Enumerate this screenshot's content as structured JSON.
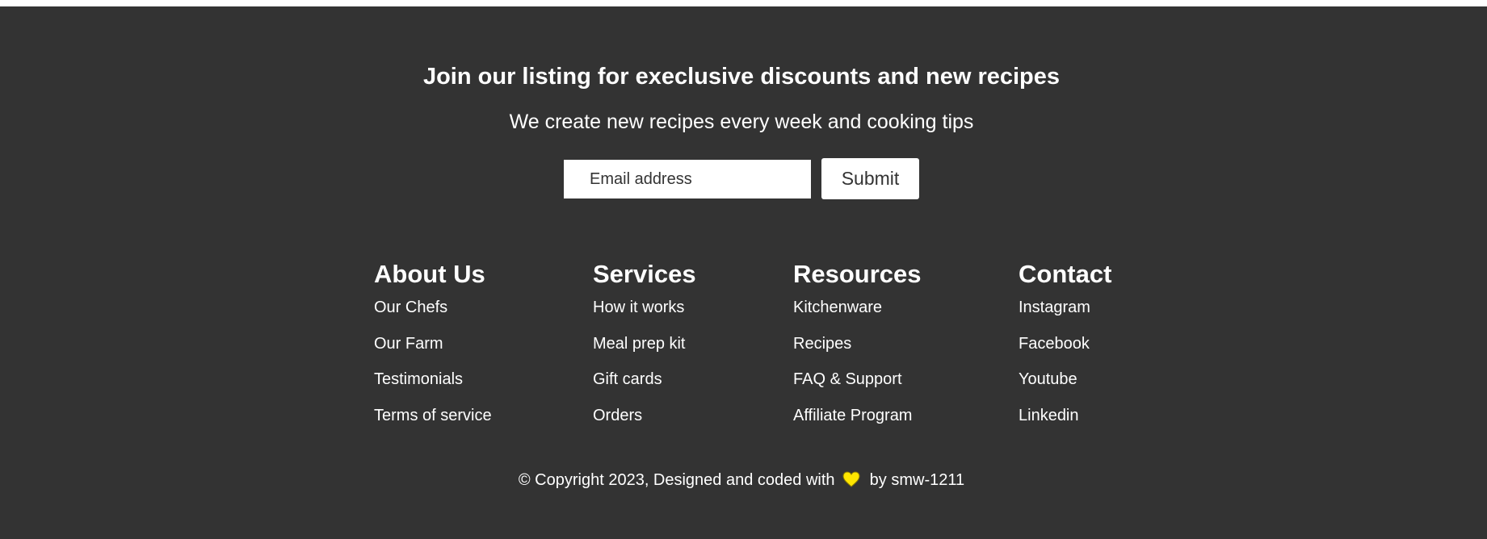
{
  "newsletter": {
    "title": "Join our listing for execlusive discounts and new recipes",
    "subtitle": "We create new recipes every week and cooking tips",
    "email_placeholder": "Email address",
    "submit_label": "Submit"
  },
  "columns": [
    {
      "heading": "About Us",
      "links": [
        "Our Chefs",
        "Our Farm",
        "Testimonials",
        "Terms of service"
      ]
    },
    {
      "heading": "Services",
      "links": [
        "How it works",
        "Meal prep kit",
        "Gift cards",
        "Orders"
      ]
    },
    {
      "heading": "Resources",
      "links": [
        "Kitchenware",
        "Recipes",
        "FAQ & Support",
        "Affiliate Program"
      ]
    },
    {
      "heading": "Contact",
      "links": [
        "Instagram",
        "Facebook",
        "Youtube",
        "Linkedin"
      ]
    }
  ],
  "copyright": {
    "prefix": "© Copyright 2023, Designed and coded with",
    "icon": "heart-icon",
    "suffix": "by smw-1211"
  },
  "colors": {
    "background": "#333333",
    "text": "#ffffff",
    "heart": "#ffe600"
  }
}
